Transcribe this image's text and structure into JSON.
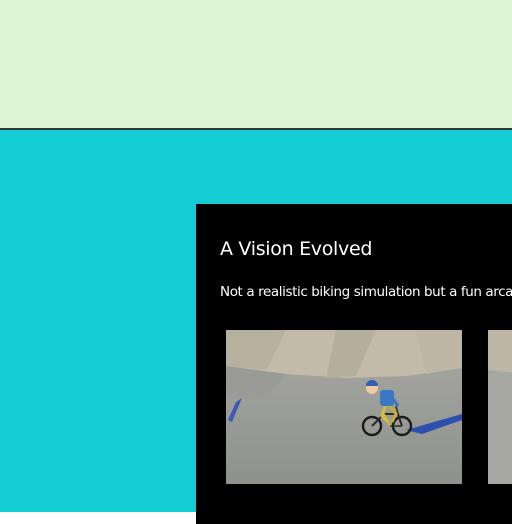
{
  "page": {
    "colors": {
      "top_band": "#def3d3",
      "divider": "#2f3a37",
      "teal_background": "#14ccd3",
      "panel_background": "#000000",
      "panel_text": "#ffffff"
    }
  },
  "panel": {
    "title": "A Vision Evolved",
    "description": "Not a realistic biking simulation but a fun arca",
    "media": [
      {
        "kind": "image",
        "subject": "rider-on-bmx-bike"
      },
      {
        "kind": "image",
        "subject": "partially-visible-second-image"
      }
    ]
  }
}
